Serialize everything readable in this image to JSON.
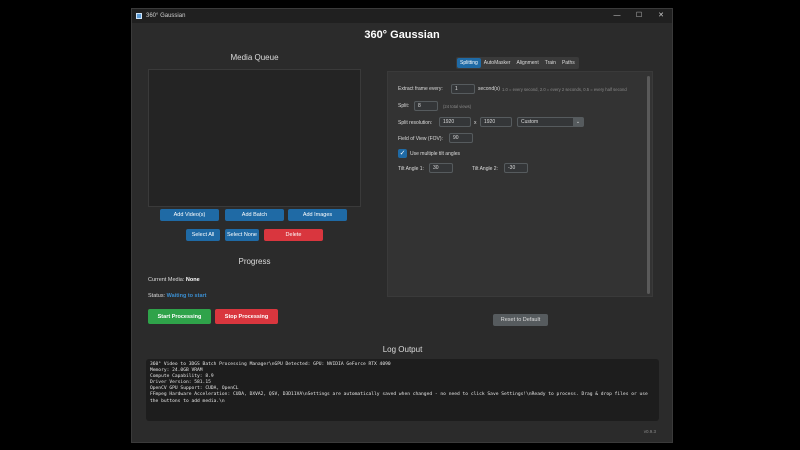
{
  "window": {
    "title": "360° Gaussian",
    "controls": {
      "minimize": "—",
      "maximize": "☐",
      "close": "✕"
    }
  },
  "app": {
    "heading": "360° Gaussian",
    "version": "v0.9.3"
  },
  "media_queue": {
    "title": "Media Queue",
    "buttons": {
      "add_videos": "Add Video(s)",
      "add_batch": "Add Batch",
      "add_images": "Add Images",
      "select_all": "Select All",
      "select_none": "Select None",
      "delete": "Delete"
    }
  },
  "progress": {
    "title": "Progress",
    "current_media_label": "Current Media:",
    "current_media_value": "None",
    "status_label": "Status:",
    "status_value": "Waiting to start",
    "start_button": "Start Processing",
    "stop_button": "Stop Processing"
  },
  "tabs": [
    {
      "label": "Splitting",
      "active": true
    },
    {
      "label": "AutoMasker",
      "active": false
    },
    {
      "label": "Alignment",
      "active": false
    },
    {
      "label": "Train",
      "active": false
    },
    {
      "label": "Paths",
      "active": false
    }
  ],
  "splitting": {
    "extract_label": "Extract frame every:",
    "extract_value": "1",
    "extract_unit": "second(s)",
    "extract_hint": "1.0 = every second, 2.0 = every 2 seconds, 0.5 = every half second",
    "split_label": "Split:",
    "split_value": "8",
    "split_hint": "(24 total views)",
    "resolution_label": "Split resolution:",
    "res_width": "1920",
    "res_x": "x",
    "res_height": "1920",
    "res_preset": "Custom",
    "fov_label": "Field of View (FOV):",
    "fov_value": "90",
    "multi_tilt_label": "Use multiple tilt angles",
    "multi_tilt_checked": true,
    "tilt1_label": "Tilt Angle 1:",
    "tilt1_value": "30",
    "tilt2_label": "Tilt Angle 2:",
    "tilt2_value": "-30",
    "reset_button": "Reset to Default"
  },
  "log": {
    "title": "Log Output",
    "text": "360° Video to 3DGS Batch Processing Manager\\nGPU Detected: GPU: NVIDIA GeForce RTX 4090\nMemory: 24.0GB VRAM\nCompute Capability: 8.9\nDriver Version: 581.15\nOpenCV GPU Support: CUDA, OpenCL\nFFmpeg Hardware Acceleration: CUDA, DXVA2, QSV, D3D11VA\\nSettings are automatically saved when changed - no need to click Save Settings!\\nReady to process. Drag & drop files or use the buttons to add media.\\n"
  },
  "colors": {
    "accent": "#1f6aa5",
    "danger": "#d9363e",
    "success": "#2fa34a",
    "background": "#2b2b2b"
  }
}
